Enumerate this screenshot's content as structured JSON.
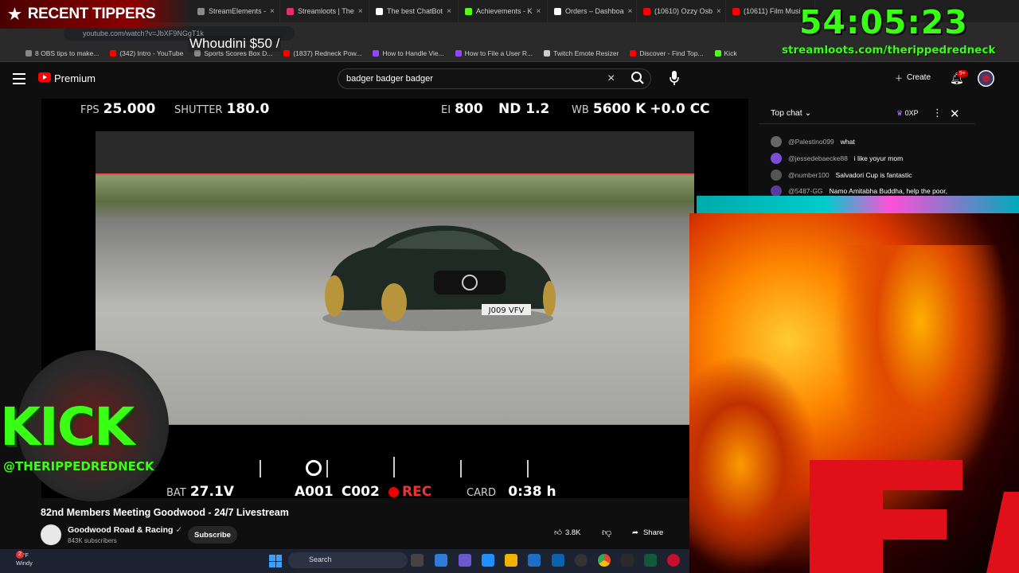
{
  "browser": {
    "tabs": [
      {
        "label": "StreamElements -",
        "color": "#8a8a8a"
      },
      {
        "label": "Streamloots | The",
        "color": "#e0306a"
      },
      {
        "label": "The best ChatBot",
        "color": "#ffffff"
      },
      {
        "label": "Achievements - K",
        "color": "#53fc18"
      },
      {
        "label": "Orders – Dashboa",
        "color": "#ffffff"
      },
      {
        "label": "(10610) Ozzy Osb",
        "color": "#ff0000"
      },
      {
        "label": "(10611) Film Musi",
        "color": "#ff0000"
      }
    ],
    "url": "youtube.com/watch?v=JbXF9NGgT1k",
    "bookmarks": [
      {
        "label": "8 OBS tips to make...",
        "color": "#888888"
      },
      {
        "label": "(342) Intro - YouTube",
        "color": "#ff0000"
      },
      {
        "label": "Sports Scores Box D...",
        "color": "#888888"
      },
      {
        "label": "(1837) Redneck Pow...",
        "color": "#ff0000"
      },
      {
        "label": "How to Handle Vie...",
        "color": "#9146ff"
      },
      {
        "label": "How to File a User R...",
        "color": "#9146ff"
      },
      {
        "label": "Twitch Emote Resizer",
        "color": "#cccccc"
      },
      {
        "label": "Discover - Find Top...",
        "color": "#ff0000"
      },
      {
        "label": "Kick",
        "color": "#53fc18"
      }
    ]
  },
  "overlay": {
    "tipper_title": "RECENT TIPPERS",
    "tipper_line": "Whoudini $50 /",
    "timer": "54:05:23",
    "streamloots_url": "streamloots.com/therippedredneck",
    "kick_text": "KICK",
    "kick_handle": "@THERIPPEDREDNECK"
  },
  "youtube": {
    "brand": "Premium",
    "search_value": "badger badger badger",
    "create_label": "Create",
    "notif_badge": "9+"
  },
  "video_hud": {
    "fps_label": "FPS",
    "fps_value": "25.000",
    "shutter_label": "SHUTTER",
    "shutter_value": "180.0",
    "ei_label": "EI",
    "ei_value": "800",
    "nd_value": "ND 1.2",
    "wb_label": "WB",
    "wb_value": "5600 K",
    "cc_value": "+0.0 CC",
    "bat_label": "BAT",
    "bat_value": "27.1V",
    "clip_a": "A001",
    "clip_c": "C002",
    "rec_label": "REC",
    "card_label": "CARD",
    "card_value": "0:38 h",
    "plate": "J009 VFV"
  },
  "chat": {
    "mode": "Top chat",
    "xp": "0XP",
    "messages": [
      {
        "user": "@Palestino099",
        "text": "what",
        "color": "#666666"
      },
      {
        "user": "@jessedebaecke88",
        "text": "i like yoyur mom",
        "color": "#7a4fd8"
      },
      {
        "user": "@number100",
        "text": "Salvadori Cup is fantastic",
        "color": "#555555"
      },
      {
        "user": "@5487-GG",
        "text": "Namo Amitabha Buddha, help the poor,",
        "color": "#5a3ca0"
      }
    ]
  },
  "video_info": {
    "title": "82nd Members Meeting Goodwood - 24/7 Livestream",
    "channel": "Goodwood Road & Racing",
    "subscribers": "843K subscribers",
    "subscribe_label": "Subscribe",
    "likes": "3.8K",
    "share_label": "Share"
  },
  "taskbar": {
    "temp": "37°F",
    "condition": "Windy",
    "search_label": "Search",
    "badge": "2"
  }
}
